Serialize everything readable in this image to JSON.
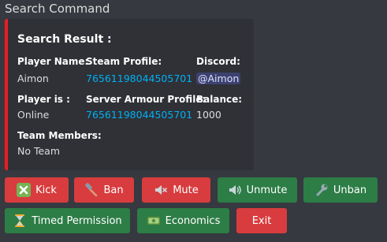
{
  "header": {
    "title": "Search Command"
  },
  "embed": {
    "title": "Search Result :",
    "accent_color": "#ed1c24",
    "fields": {
      "player_name": {
        "name": "Player Name:",
        "value": "Aimon"
      },
      "steam_profile": {
        "name": "Steam Profile:",
        "value": "76561198044505701"
      },
      "discord": {
        "name": "Discord:",
        "value": "@Aimon"
      },
      "player_is": {
        "name": "Player is :",
        "value": "Online"
      },
      "server_armour": {
        "name": "Server Armour Profile:",
        "value": "76561198044505701"
      },
      "balance": {
        "name": "Balance:",
        "value": "1000"
      },
      "team_members": {
        "name": "Team Members:",
        "value": "No Team"
      }
    }
  },
  "buttons": {
    "kick": {
      "label": "Kick",
      "icon": "x-mark-icon",
      "color": "#d83c3e"
    },
    "ban": {
      "label": "Ban",
      "icon": "hammer-icon",
      "color": "#d83c3e"
    },
    "mute": {
      "label": "Mute",
      "icon": "speaker-muted-icon",
      "color": "#d83c3e"
    },
    "unmute": {
      "label": "Unmute",
      "icon": "speaker-icon",
      "color": "#2d7d46"
    },
    "unban": {
      "label": "Unban",
      "icon": "wrench-icon",
      "color": "#2d7d46"
    },
    "timed_permission": {
      "label": "Timed Permission",
      "icon": "hourglass-icon",
      "color": "#2d7d46"
    },
    "economics": {
      "label": "Economics",
      "icon": "money-icon",
      "color": "#2d7d46"
    },
    "exit": {
      "label": "Exit",
      "icon": "",
      "color": "#d83c3e"
    }
  }
}
